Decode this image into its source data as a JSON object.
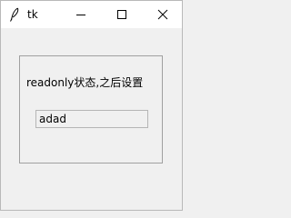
{
  "window": {
    "title": "tk",
    "icons": {
      "app": "feather-icon",
      "minimize": "minimize-icon",
      "maximize": "maximize-icon",
      "close": "close-icon"
    }
  },
  "labelframe": {
    "label": "readonly状态,之后设置"
  },
  "entry": {
    "value": "adad",
    "state": "readonly"
  }
}
